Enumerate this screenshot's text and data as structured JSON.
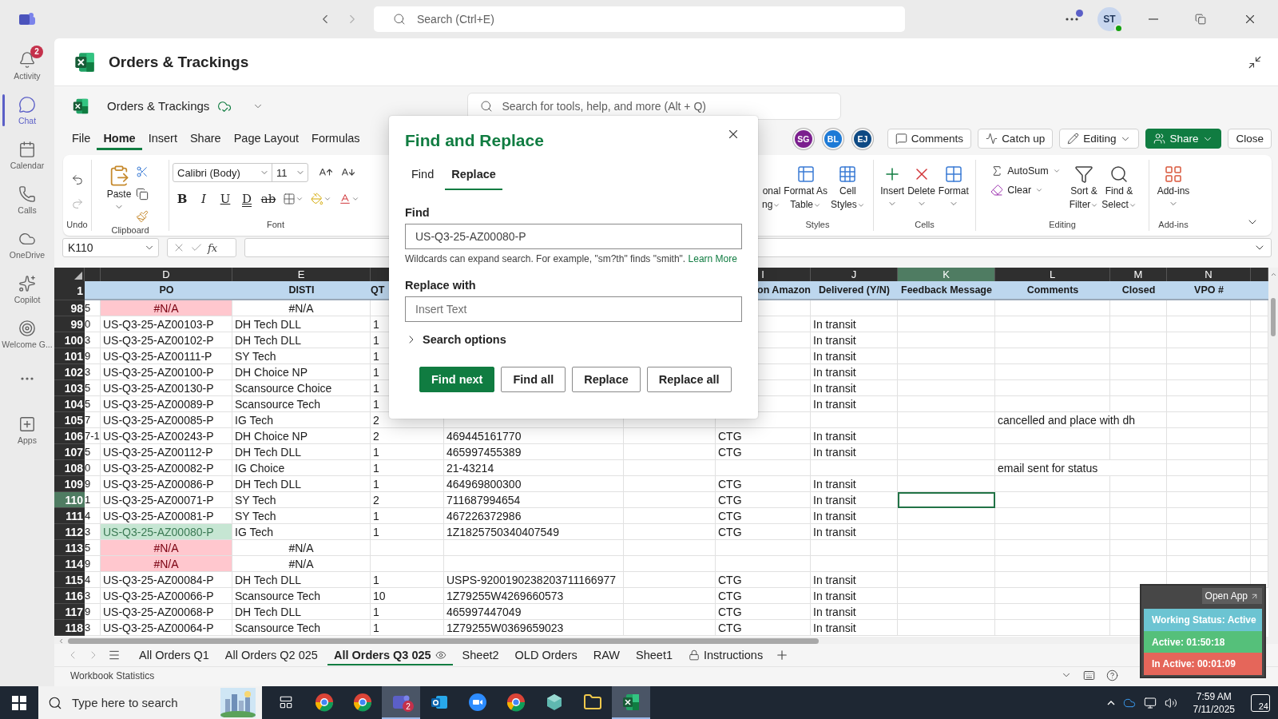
{
  "top_bar": {
    "search": {
      "placeholder": "Search (Ctrl+E)"
    },
    "avatar": "ST"
  },
  "rail": [
    {
      "kind": "bell",
      "label": "Activity",
      "badge": "2",
      "selected": false
    },
    {
      "kind": "chat",
      "label": "Chat",
      "selected": true
    },
    {
      "kind": "calendar",
      "label": "Calendar",
      "selected": false
    },
    {
      "kind": "phone",
      "label": "Calls",
      "selected": false
    },
    {
      "kind": "cloud",
      "label": "OneDrive",
      "selected": false
    },
    {
      "kind": "copilot",
      "label": "Copilot",
      "selected": false
    },
    {
      "kind": "welcome",
      "label": "Welcome G...",
      "selected": false
    },
    {
      "kind": "more",
      "selected": false
    },
    {
      "kind": "apps",
      "label": "Apps",
      "selected": false
    }
  ],
  "app_title": "Orders & Trackings",
  "workbook": {
    "name": "Orders & Trackings",
    "search": {
      "placeholder": "Search for tools, help, and more (Alt + Q)"
    }
  },
  "menu_tabs": [
    {
      "label": "File",
      "selected": false
    },
    {
      "label": "Home",
      "selected": true
    },
    {
      "label": "Insert",
      "selected": false
    },
    {
      "label": "Share",
      "selected": false
    },
    {
      "label": "Page Layout",
      "selected": false
    },
    {
      "label": "Formulas",
      "selected": false
    }
  ],
  "collaborators": [
    {
      "initials": "SG",
      "color": "#7b1f8e"
    },
    {
      "initials": "BL",
      "color": "#1d7ad6"
    },
    {
      "initials": "EJ",
      "color": "#0e4a84"
    }
  ],
  "actions": [
    {
      "label": "Comments",
      "kind": "comments"
    },
    {
      "label": "Catch up",
      "kind": "catchup"
    },
    {
      "label": "Editing",
      "kind": "editing"
    },
    {
      "label": "Share",
      "kind": "share"
    },
    {
      "label": "Close",
      "kind": "close"
    }
  ],
  "ribbon": {
    "undo": "Undo",
    "clipboard": {
      "label": "Clipboard",
      "paste": "Paste"
    },
    "font": {
      "label": "Font",
      "family": "Calibri (Body)",
      "size": "11",
      "format": [
        {
          "label": "B",
          "kind": "bold"
        },
        {
          "label": "I",
          "kind": "italic"
        },
        {
          "label": "U",
          "kind": "underline"
        },
        {
          "label": "D",
          "kind": "double"
        },
        {
          "label": "ab",
          "kind": "strike"
        }
      ]
    },
    "groups": [
      {
        "label": "Styles",
        "buttons": [
          {
            "kind": "partial",
            "lines": [
              "onal",
              "ng"
            ]
          },
          {
            "kind": "table",
            "lines": [
              "Format As",
              "Table"
            ]
          },
          {
            "kind": "cellstyles",
            "lines": [
              "Cell",
              "Styles"
            ]
          }
        ]
      },
      {
        "label": "Cells",
        "buttons": [
          {
            "kind": "insert",
            "lines": [
              "Insert"
            ]
          },
          {
            "kind": "delete",
            "lines": [
              "Delete"
            ]
          },
          {
            "kind": "format",
            "lines": [
              "Format"
            ]
          }
        ]
      },
      {
        "label": "Editing",
        "buttons": [
          {
            "kind": "autosum",
            "lines": [
              "AutoSum"
            ]
          },
          {
            "kind": "clear",
            "lines": [
              "Clear"
            ]
          },
          {
            "kind": "sort",
            "lines": [
              "Sort &",
              "Filter"
            ]
          },
          {
            "kind": "find",
            "lines": [
              "Find &",
              "Select"
            ]
          }
        ]
      },
      {
        "label": "Add-ins",
        "buttons": [
          {
            "kind": "addins",
            "lines": [
              "Add-ins"
            ]
          }
        ]
      }
    ]
  },
  "formula_bar": {
    "name_box": "K110",
    "function_label": "fx"
  },
  "grid": {
    "column_letters": [
      {
        "letter": "D",
        "selected": false
      },
      {
        "letter": "E",
        "selected": false
      },
      {
        "letter": "I",
        "selected": false
      },
      {
        "letter": "J",
        "selected": false
      },
      {
        "letter": "K",
        "selected": true
      },
      {
        "letter": "L",
        "selected": false
      },
      {
        "letter": "M",
        "selected": false
      },
      {
        "letter": "N",
        "selected": false
      }
    ],
    "header_row": {
      "number": "1",
      "po": "PO",
      "disti": "DISTI",
      "qty": "QT",
      "column_9": "on Amazon",
      "delivered": "Delivered (Y/N)",
      "feedback": "Feedback Message",
      "comments": "Comments",
      "closed": "Closed",
      "vpo": "VPO #"
    },
    "rows": [
      {
        "number": "98",
        "column_3": "5",
        "po": "#N/A",
        "disti": "#N/A",
        "error": true,
        "found": false,
        "selected": false
      },
      {
        "number": "99",
        "column_3": "0",
        "po": "US-Q3-25-AZ00103-P",
        "disti": "DH Tech DLL",
        "qty": "1",
        "delivered": "In transit",
        "error": false,
        "found": false,
        "selected": false
      },
      {
        "number": "100",
        "column_3": "3",
        "po": "US-Q3-25-AZ00102-P",
        "disti": "DH Tech DLL",
        "qty": "1",
        "delivered": "In transit",
        "error": false,
        "found": false,
        "selected": false
      },
      {
        "number": "101",
        "column_3": "9",
        "po": "US-Q3-25-AZ00111-P",
        "disti": "SY Tech",
        "qty": "1",
        "delivered": "In transit",
        "error": false,
        "found": false,
        "selected": false
      },
      {
        "number": "102",
        "column_3": "3",
        "po": "US-Q3-25-AZ00100-P",
        "disti": "DH Choice NP",
        "qty": "1",
        "delivered": "In transit",
        "error": false,
        "found": false,
        "selected": false
      },
      {
        "number": "103",
        "column_3": "5",
        "po": "US-Q3-25-AZ00130-P",
        "disti": "Scansource Choice",
        "qty": "1",
        "delivered": "In transit",
        "error": false,
        "found": false,
        "selected": false
      },
      {
        "number": "104",
        "column_3": "5",
        "po": "US-Q3-25-AZ00089-P",
        "disti": "Scansource Tech",
        "qty": "1",
        "delivered": "In transit",
        "error": false,
        "found": false,
        "selected": false
      },
      {
        "number": "105",
        "column_3": "7",
        "po": "US-Q3-25-AZ00085-P",
        "disti": "IG Tech",
        "qty": "2",
        "comments": "cancelled and place with dh",
        "error": false,
        "found": false,
        "selected": false
      },
      {
        "number": "106",
        "column_3": "7-1",
        "po": "US-Q3-25-AZ00243-P",
        "disti": "DH Choice NP",
        "qty": "2",
        "column_7": "469445161770",
        "column_9": "CTG",
        "delivered": "In transit",
        "error": false,
        "found": false,
        "selected": false
      },
      {
        "number": "107",
        "column_3": "5",
        "po": "US-Q3-25-AZ00112-P",
        "disti": "DH Tech DLL",
        "qty": "1",
        "column_7": "465997455389",
        "column_9": "CTG",
        "delivered": "In transit",
        "error": false,
        "found": false,
        "selected": false
      },
      {
        "number": "108",
        "column_3": "0",
        "po": "US-Q3-25-AZ00082-P",
        "disti": "IG Choice",
        "qty": "1",
        "column_7": "21-43214",
        "comments": "email sent for status",
        "error": false,
        "found": false,
        "selected": false
      },
      {
        "number": "109",
        "column_3": "9",
        "po": "US-Q3-25-AZ00086-P",
        "disti": "DH Tech DLL",
        "qty": "1",
        "column_7": "464969800300",
        "column_9": "CTG",
        "delivered": "In transit",
        "error": false,
        "found": false,
        "selected": false
      },
      {
        "number": "110",
        "column_3": "1",
        "po": "US-Q3-25-AZ00071-P",
        "disti": "SY Tech",
        "qty": "2",
        "column_7": "711687994654",
        "column_9": "CTG",
        "delivered": "In transit",
        "error": false,
        "found": false,
        "selected": true
      },
      {
        "number": "111",
        "column_3": "4",
        "po": "US-Q3-25-AZ00081-P",
        "disti": "SY Tech",
        "qty": "1",
        "column_7": "467226372986",
        "column_9": "CTG",
        "delivered": "In transit",
        "error": false,
        "found": false,
        "selected": false
      },
      {
        "number": "112",
        "column_3": "3",
        "po": "US-Q3-25-AZ00080-P",
        "disti": "IG Tech",
        "qty": "1",
        "column_7": "1Z1825750340407549",
        "column_9": "CTG",
        "delivered": "In transit",
        "error": false,
        "found": true,
        "selected": false
      },
      {
        "number": "113",
        "column_3": "5",
        "po": "#N/A",
        "disti": "#N/A",
        "error": true,
        "found": false,
        "selected": false
      },
      {
        "number": "114",
        "column_3": "9",
        "po": "#N/A",
        "disti": "#N/A",
        "error": true,
        "found": false,
        "selected": false
      },
      {
        "number": "115",
        "column_3": "4",
        "po": "US-Q3-25-AZ00084-P",
        "disti": "DH Tech DLL",
        "qty": "1",
        "column_7": "USPS-9200190238203711166977",
        "column_9": "CTG",
        "delivered": "In transit",
        "error": false,
        "found": false,
        "selected": false
      },
      {
        "number": "116",
        "column_3": "3",
        "po": "US-Q3-25-AZ00066-P",
        "disti": "Scansource Tech",
        "qty": "10",
        "column_7": "1Z79255W4269660573",
        "column_9": "CTG",
        "delivered": "In transit",
        "error": false,
        "found": false,
        "selected": false
      },
      {
        "number": "117",
        "column_3": "9",
        "po": "US-Q3-25-AZ00068-P",
        "disti": "DH Tech DLL",
        "qty": "1",
        "column_7": "465997447049",
        "column_9": "CTG",
        "delivered": "In transit",
        "error": false,
        "found": false,
        "selected": false
      },
      {
        "number": "118",
        "column_3": "3",
        "po": "US-Q3-25-AZ00064-P",
        "disti": "Scansource Tech",
        "qty": "1",
        "column_7": "1Z79255W0369659023",
        "column_9": "CTG",
        "delivered": "In transit",
        "error": false,
        "found": false,
        "selected": false
      }
    ]
  },
  "sheet_tabs": [
    {
      "label": "All Orders Q1",
      "kind": "plain",
      "selected": false
    },
    {
      "label": "All Orders Q2 025",
      "kind": "plain",
      "selected": false
    },
    {
      "label": "All Orders Q3 025",
      "kind": "viewed",
      "selected": true
    },
    {
      "label": "Sheet2",
      "kind": "plain",
      "selected": false
    },
    {
      "label": "OLD Orders",
      "kind": "plain",
      "selected": false
    },
    {
      "label": "RAW",
      "kind": "plain",
      "selected": false
    },
    {
      "label": "Sheet1",
      "kind": "plain",
      "selected": false
    },
    {
      "label": "Instructions",
      "kind": "locked",
      "selected": false
    }
  ],
  "status_bar": {
    "label": "Workbook Statistics"
  },
  "dialog": {
    "title": "Find and Replace",
    "tabs": [
      {
        "label": "Find",
        "selected": false
      },
      {
        "label": "Replace",
        "selected": true
      }
    ],
    "find": {
      "label": "Find",
      "value": "US-Q3-25-AZ00080-P",
      "hint": "Wildcards can expand search. For example, \"sm?th\" finds \"smith\".",
      "link": "Learn More"
    },
    "replace": {
      "label": "Replace with",
      "placeholder": "Insert Text"
    },
    "options": {
      "label": "Search options",
      "expanded": false
    },
    "buttons": [
      {
        "label": "Find next",
        "kind": "primary"
      },
      {
        "label": "Find all",
        "kind": "secondary"
      },
      {
        "label": "Replace",
        "kind": "secondary"
      },
      {
        "label": "Replace all",
        "kind": "secondary"
      }
    ]
  },
  "tracker": {
    "open_label": "Open App",
    "statuses": [
      {
        "label": "Working Status: Active",
        "color": "#6cc4d2"
      },
      {
        "label": "Active: 01:50:18",
        "color": "#55c07a"
      },
      {
        "label": "In Active: 00:01:09",
        "color": "#e5665a"
      }
    ]
  },
  "taskbar": {
    "search": {
      "placeholder": "Type here to search"
    },
    "apps": [
      {
        "kind": "browser",
        "selected": false
      },
      {
        "kind": "browser",
        "selected": false
      },
      {
        "kind": "chat",
        "badge": "2",
        "selected": true
      },
      {
        "kind": "mail",
        "selected": false
      },
      {
        "kind": "video",
        "selected": false
      },
      {
        "kind": "browser",
        "selected": false
      },
      {
        "kind": "cube",
        "selected": false
      },
      {
        "kind": "folder",
        "selected": false
      },
      {
        "kind": "sheet",
        "selected": true
      }
    ],
    "time": "7:59 AM",
    "date": "7/11/2025",
    "notifications": "24"
  }
}
